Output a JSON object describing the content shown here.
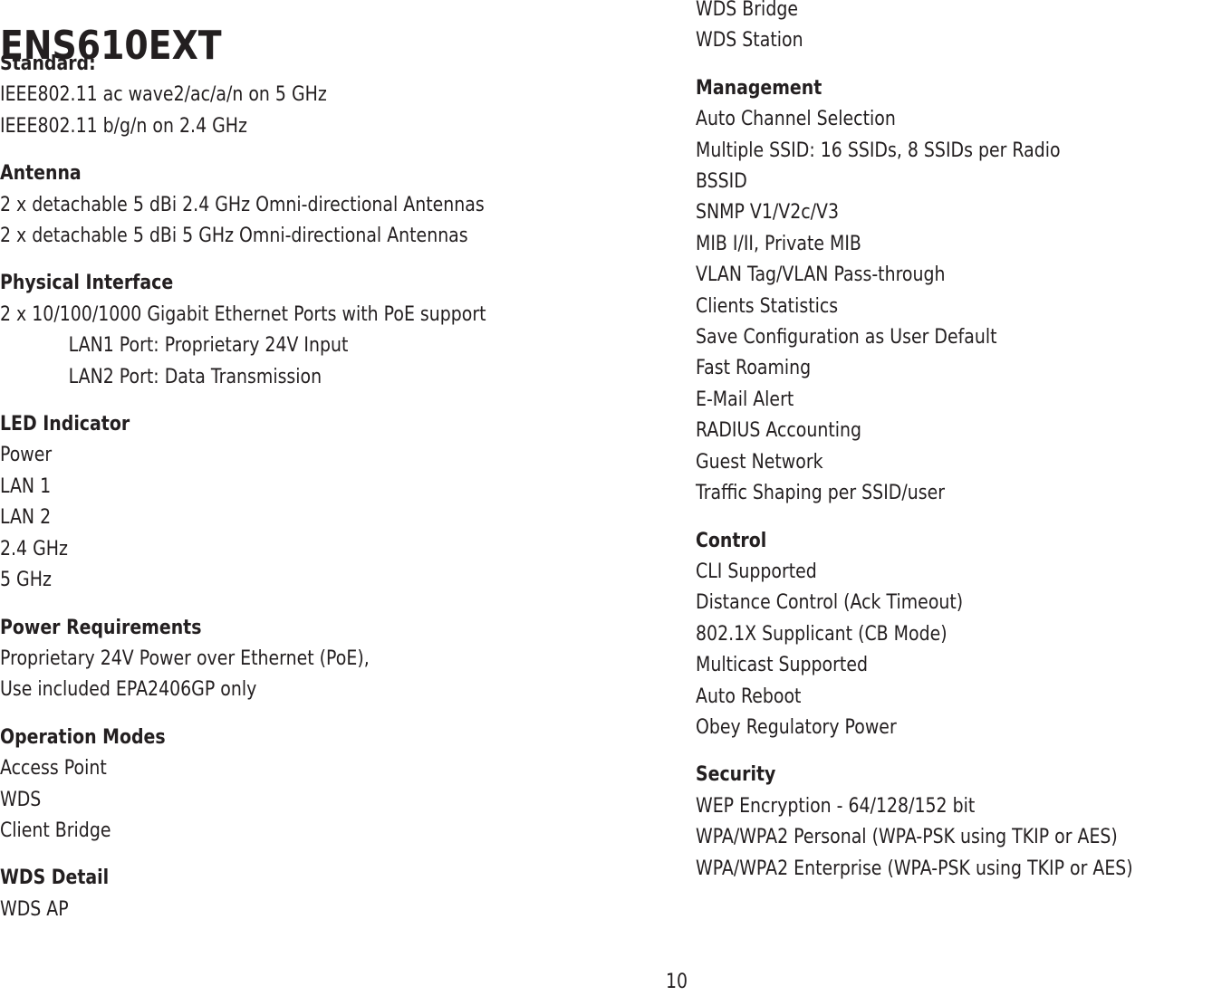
{
  "document": {
    "title": "ENS610EXT",
    "page_number": "10"
  },
  "left_column": [
    {
      "heading": "Standard:",
      "lines": [
        {
          "text": "IEEE802.11 ac wave2/ac/a/n on 5 GHz",
          "indent": false
        },
        {
          "text": "IEEE802.11 b/g/n on 2.4 GHz",
          "indent": false
        }
      ]
    },
    {
      "heading": "Antenna",
      "lines": [
        {
          "text": "2 x detachable 5 dBi 2.4 GHz Omni-directional Antennas",
          "indent": false
        },
        {
          "text": "2 x detachable 5 dBi 5 GHz Omni-directional Antennas",
          "indent": false
        }
      ]
    },
    {
      "heading": "Physical Interface",
      "lines": [
        {
          "text": "2 x 10/100/1000 Gigabit Ethernet Ports with PoE support",
          "indent": false
        },
        {
          "text": "LAN1 Port: Proprietary 24V Input",
          "indent": true
        },
        {
          "text": "LAN2 Port: Data Transmission",
          "indent": true
        }
      ]
    },
    {
      "heading": "LED Indicator",
      "lines": [
        {
          "text": "Power",
          "indent": false
        },
        {
          "text": "LAN 1",
          "indent": false
        },
        {
          "text": "LAN 2",
          "indent": false
        },
        {
          "text": "2.4 GHz",
          "indent": false
        },
        {
          "text": "5 GHz",
          "indent": false
        }
      ]
    },
    {
      "heading": "Power Requirements",
      "lines": [
        {
          "text": "Proprietary 24V Power over Ethernet (PoE),",
          "indent": false
        },
        {
          "text": "Use included EPA2406GP only",
          "indent": false
        }
      ]
    },
    {
      "heading": "Operation Modes",
      "lines": [
        {
          "text": "Access Point",
          "indent": false
        },
        {
          "text": "WDS",
          "indent": false
        },
        {
          "text": "Client Bridge",
          "indent": false
        }
      ]
    },
    {
      "heading": "WDS Detail",
      "lines": [
        {
          "text": "WDS AP",
          "indent": false
        }
      ]
    }
  ],
  "right_column": [
    {
      "heading": "",
      "lines": [
        {
          "text": "WDS Bridge",
          "indent": false
        },
        {
          "text": "WDS Station",
          "indent": false
        }
      ]
    },
    {
      "heading": "Management",
      "lines": [
        {
          "text": "Auto Channel Selection",
          "indent": false
        },
        {
          "text": "Multiple SSID: 16 SSIDs, 8 SSIDs per Radio",
          "indent": false
        },
        {
          "text": "BSSID",
          "indent": false
        },
        {
          "text": "SNMP V1/V2c/V3",
          "indent": false
        },
        {
          "text": "MIB I/II, Private MIB",
          "indent": false
        },
        {
          "text": "VLAN Tag/VLAN Pass-through",
          "indent": false
        },
        {
          "text": "Clients Statistics",
          "indent": false
        },
        {
          "text": "Save Configuration as User Default",
          "indent": false
        },
        {
          "text": "Fast Roaming",
          "indent": false
        },
        {
          "text": "E-Mail Alert",
          "indent": false
        },
        {
          "text": "RADIUS Accounting",
          "indent": false
        },
        {
          "text": "Guest Network",
          "indent": false
        },
        {
          "text": "Traffic Shaping per SSID/user",
          "indent": false
        }
      ]
    },
    {
      "heading": "Control",
      "lines": [
        {
          "text": "CLI Supported",
          "indent": false
        },
        {
          "text": "Distance Control (Ack Timeout)",
          "indent": false
        },
        {
          "text": "802.1X Supplicant (CB Mode)",
          "indent": false
        },
        {
          "text": "Multicast Supported",
          "indent": false
        },
        {
          "text": "Auto Reboot",
          "indent": false
        },
        {
          "text": "Obey Regulatory Power",
          "indent": false
        }
      ]
    },
    {
      "heading": "Security",
      "lines": [
        {
          "text": "WEP Encryption - 64/128/152 bit",
          "indent": false
        },
        {
          "text": "WPA/WPA2 Personal (WPA-PSK using TKIP or AES)",
          "indent": false
        },
        {
          "text": "WPA/WPA2 Enterprise (WPA-PSK using TKIP or AES)",
          "indent": false
        }
      ]
    }
  ]
}
